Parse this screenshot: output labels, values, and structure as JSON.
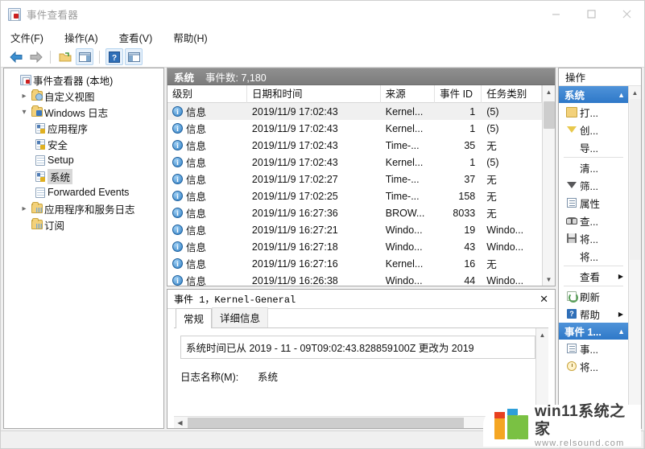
{
  "window": {
    "title": "事件查看器",
    "icon": "event-viewer-icon",
    "controls": {
      "minimize": "minimize-icon",
      "maximize": "maximize-icon",
      "close": "close-icon"
    }
  },
  "menu": {
    "items": [
      {
        "label": "文件(F)",
        "name": "menu-file"
      },
      {
        "label": "操作(A)",
        "name": "menu-action"
      },
      {
        "label": "查看(V)",
        "name": "menu-view"
      },
      {
        "label": "帮助(H)",
        "name": "menu-help"
      }
    ]
  },
  "toolbar": {
    "buttons": [
      {
        "name": "back-icon"
      },
      {
        "name": "forward-icon"
      },
      {
        "name": "open-saved-log-icon"
      },
      {
        "name": "show-hide-console-tree-icon"
      },
      {
        "name": "help-icon"
      },
      {
        "name": "show-hide-action-pane-icon"
      }
    ]
  },
  "tree": {
    "nodes": [
      {
        "label": "事件查看器 (本地)",
        "icon": "event-viewer-icon",
        "indent": 0,
        "twist": "",
        "selected": false
      },
      {
        "label": "自定义视图",
        "icon": "folder-custom-views-icon",
        "indent": 1,
        "twist": "collapsed",
        "selected": false
      },
      {
        "label": "Windows 日志",
        "icon": "folder-windows-logs-icon",
        "indent": 1,
        "twist": "expanded",
        "selected": false
      },
      {
        "label": "应用程序",
        "icon": "log-application-icon",
        "indent": 2,
        "twist": "",
        "selected": false
      },
      {
        "label": "安全",
        "icon": "log-security-icon",
        "indent": 2,
        "twist": "",
        "selected": false
      },
      {
        "label": "Setup",
        "icon": "log-setup-icon",
        "indent": 2,
        "twist": "",
        "selected": false
      },
      {
        "label": "系统",
        "icon": "log-system-icon",
        "indent": 2,
        "twist": "",
        "selected": true
      },
      {
        "label": "Forwarded Events",
        "icon": "log-forwarded-events-icon",
        "indent": 2,
        "twist": "",
        "selected": false
      },
      {
        "label": "应用程序和服务日志",
        "icon": "folder-app-service-logs-icon",
        "indent": 1,
        "twist": "collapsed",
        "selected": false
      },
      {
        "label": "订阅",
        "icon": "folder-subscriptions-icon",
        "indent": 1,
        "twist": "",
        "selected": false
      }
    ]
  },
  "list": {
    "log_name": "系统",
    "event_count_label": "事件数: 7,180",
    "columns": [
      "级别",
      "日期和时间",
      "来源",
      "事件 ID",
      "任务类别"
    ],
    "rows": [
      {
        "level": "信息",
        "datetime": "2019/11/9 17:02:43",
        "source": "Kernel...",
        "event_id": "1",
        "task": "(5)",
        "selected": true
      },
      {
        "level": "信息",
        "datetime": "2019/11/9 17:02:43",
        "source": "Kernel...",
        "event_id": "1",
        "task": "(5)",
        "selected": false
      },
      {
        "level": "信息",
        "datetime": "2019/11/9 17:02:43",
        "source": "Time-...",
        "event_id": "35",
        "task": "无",
        "selected": false
      },
      {
        "level": "信息",
        "datetime": "2019/11/9 17:02:43",
        "source": "Kernel...",
        "event_id": "1",
        "task": "(5)",
        "selected": false
      },
      {
        "level": "信息",
        "datetime": "2019/11/9 17:02:27",
        "source": "Time-...",
        "event_id": "37",
        "task": "无",
        "selected": false
      },
      {
        "level": "信息",
        "datetime": "2019/11/9 17:02:25",
        "source": "Time-...",
        "event_id": "158",
        "task": "无",
        "selected": false
      },
      {
        "level": "信息",
        "datetime": "2019/11/9 16:27:36",
        "source": "BROW...",
        "event_id": "8033",
        "task": "无",
        "selected": false
      },
      {
        "level": "信息",
        "datetime": "2019/11/9 16:27:21",
        "source": "Windo...",
        "event_id": "19",
        "task": "Windo...",
        "selected": false
      },
      {
        "level": "信息",
        "datetime": "2019/11/9 16:27:18",
        "source": "Windo...",
        "event_id": "43",
        "task": "Windo...",
        "selected": false
      },
      {
        "level": "信息",
        "datetime": "2019/11/9 16:27:16",
        "source": "Kernel...",
        "event_id": "16",
        "task": "无",
        "selected": false
      },
      {
        "level": "信息",
        "datetime": "2019/11/9 16:26:38",
        "source": "Windo...",
        "event_id": "44",
        "task": "Windo...",
        "selected": false
      }
    ]
  },
  "detail": {
    "title": "事件 1，Kernel-General",
    "close": "✕",
    "tabs": [
      {
        "label": "常规",
        "active": true
      },
      {
        "label": "详细信息",
        "active": false
      }
    ],
    "description": "系统时间已从 2019 - 11 - 09T09:02:43.828859100Z 更改为 2019",
    "fields": [
      {
        "key": "日志名称(M):",
        "value": "系统"
      }
    ]
  },
  "actions": {
    "header": "操作",
    "groups": [
      {
        "title": "系统",
        "name": "actions-group-system",
        "items": [
          {
            "label": "打...",
            "icon": "open-saved-log-icon",
            "submenu": false,
            "divider_after": false
          },
          {
            "label": "创...",
            "icon": "create-custom-view-icon",
            "submenu": false,
            "divider_after": false
          },
          {
            "label": "导...",
            "icon": "",
            "submenu": false,
            "divider_after": true
          },
          {
            "label": "清...",
            "icon": "",
            "submenu": false,
            "divider_after": false
          },
          {
            "label": "筛...",
            "icon": "filter-icon",
            "submenu": false,
            "divider_after": false
          },
          {
            "label": "属性",
            "icon": "properties-icon",
            "submenu": false,
            "divider_after": false
          },
          {
            "label": "查...",
            "icon": "find-icon",
            "submenu": false,
            "divider_after": false
          },
          {
            "label": "将...",
            "icon": "save-events-icon",
            "submenu": false,
            "divider_after": false
          },
          {
            "label": "将...",
            "icon": "",
            "submenu": false,
            "divider_after": true
          },
          {
            "label": "查看",
            "icon": "",
            "submenu": true,
            "divider_after": true
          },
          {
            "label": "刷新",
            "icon": "refresh-icon",
            "submenu": false,
            "divider_after": false
          },
          {
            "label": "帮助",
            "icon": "help-icon",
            "submenu": true,
            "divider_after": false
          }
        ]
      },
      {
        "title": "事件 1...",
        "name": "actions-group-event",
        "items": [
          {
            "label": "事...",
            "icon": "event-properties-icon",
            "submenu": false,
            "divider_after": false
          },
          {
            "label": "将...",
            "icon": "attach-task-icon",
            "submenu": false,
            "divider_after": false
          }
        ]
      }
    ]
  },
  "watermark": {
    "main": "win11系统之家",
    "sub": "www.relsound.com"
  }
}
